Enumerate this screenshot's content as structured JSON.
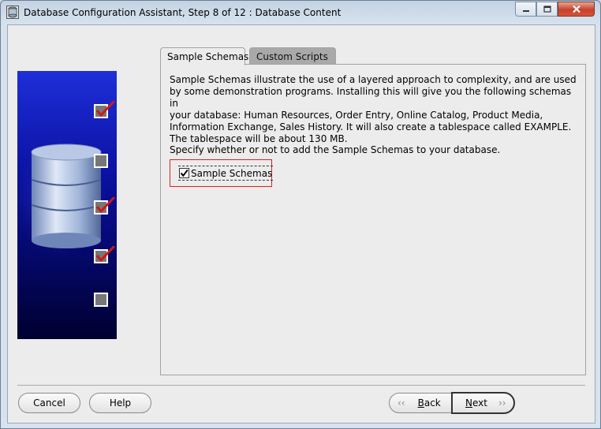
{
  "window": {
    "title": "Database Configuration Assistant, Step 8 of 12 : Database Content"
  },
  "tabs": [
    {
      "label": "Sample Schemas",
      "active": true
    },
    {
      "label": "Custom Scripts",
      "active": false
    }
  ],
  "content": {
    "description": "Sample Schemas illustrate the use of a layered approach to complexity, and are used\nby some demonstration programs. Installing this will give you the following schemas in\nyour database: Human Resources, Order Entry, Online Catalog, Product Media,\nInformation Exchange, Sales History. It will also create a tablespace called EXAMPLE.\nThe tablespace will be about 130 MB.",
    "prompt": "Specify whether or not to add the Sample Schemas to your database.",
    "checkbox": {
      "label": "Sample Schemas",
      "checked": true
    }
  },
  "side_panel": {
    "steps": [
      {
        "state": "checked"
      },
      {
        "state": "unchecked"
      },
      {
        "state": "checked"
      },
      {
        "state": "checked"
      },
      {
        "state": "unchecked"
      }
    ]
  },
  "buttons": {
    "cancel": "Cancel",
    "help": "Help",
    "back": "Back",
    "next": "Next"
  },
  "colors": {
    "highlight": "#e02020",
    "panel_gradient_top": "#1e2fd8",
    "panel_gradient_bottom": "#000030",
    "checkmark": "#d01818"
  }
}
